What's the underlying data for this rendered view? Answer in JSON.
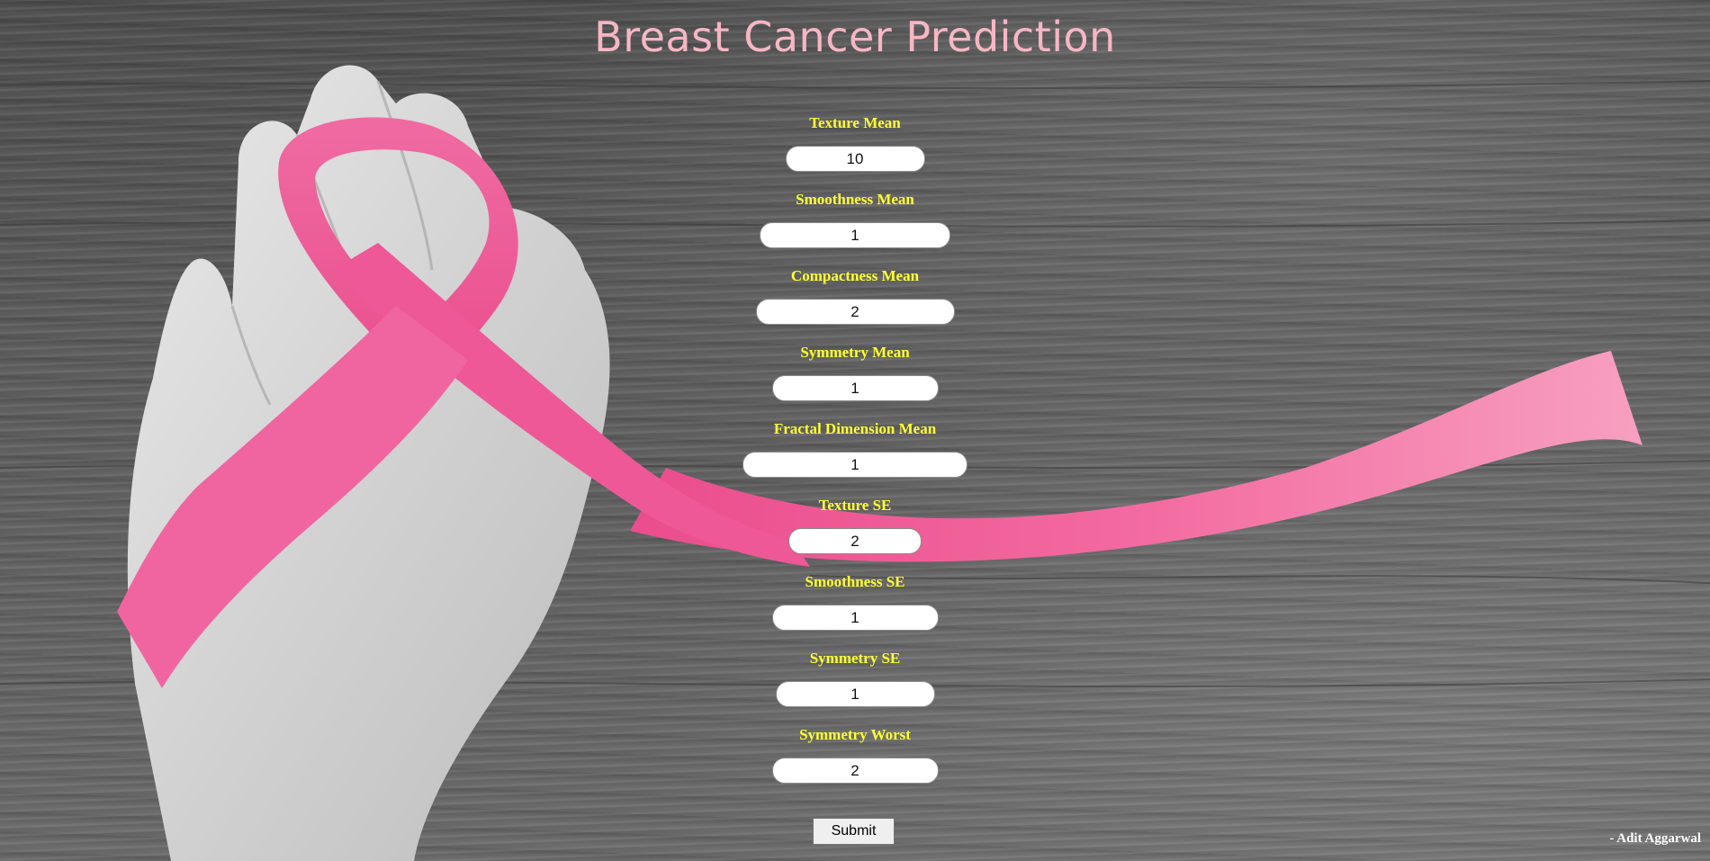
{
  "page": {
    "title": "Breast Cancer Prediction",
    "credit": "- Adit Aggarwal"
  },
  "colors": {
    "title": "#f6b6c4",
    "label": "#ffff33",
    "ribbon": "#f05a95"
  },
  "background_image": {
    "subject": "hand holding pink awareness ribbon on grey wooden planks, black-and-white with pink ribbon"
  },
  "form": {
    "fields": [
      {
        "label": "Texture Mean",
        "value": "10"
      },
      {
        "label": "Smoothness Mean",
        "value": "1"
      },
      {
        "label": "Compactness Mean",
        "value": "2"
      },
      {
        "label": "Symmetry Mean",
        "value": "1"
      },
      {
        "label": "Fractal Dimension Mean",
        "value": "1"
      },
      {
        "label": "Texture SE",
        "value": "2"
      },
      {
        "label": "Smoothness SE",
        "value": "1"
      },
      {
        "label": "Symmetry SE",
        "value": "1"
      },
      {
        "label": "Symmetry Worst",
        "value": "2"
      }
    ],
    "submit_label": "Submit"
  }
}
